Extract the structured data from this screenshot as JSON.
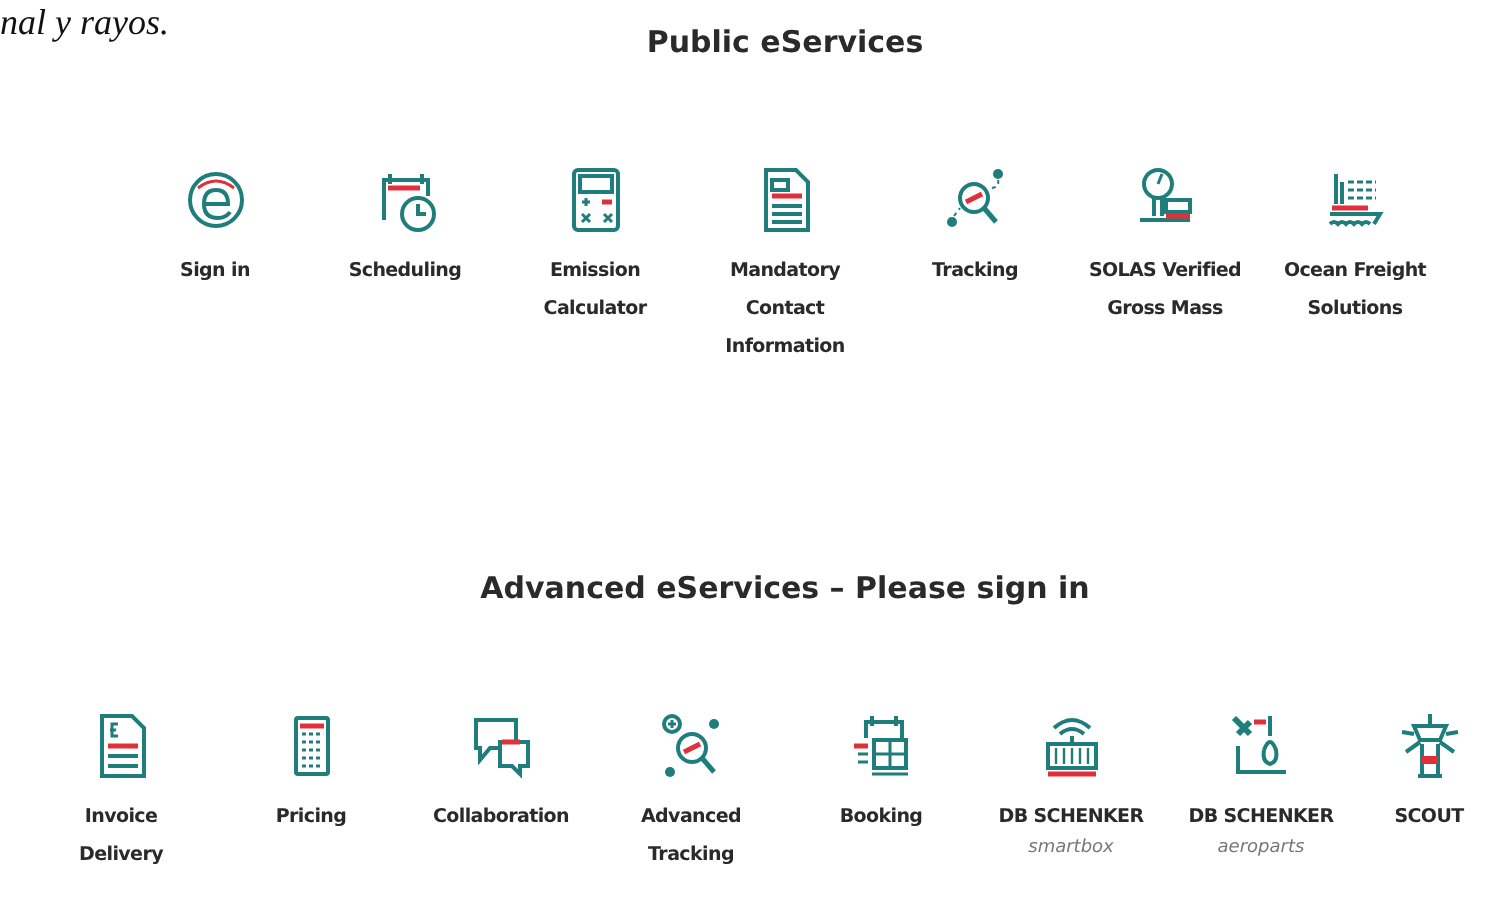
{
  "caption_fragment": "nal y rayos.",
  "sections": [
    {
      "title": "Public eServices",
      "items": [
        {
          "lines": [
            "Sign in"
          ]
        },
        {
          "lines": [
            "Scheduling"
          ]
        },
        {
          "lines": [
            "Emission",
            "Calculator"
          ]
        },
        {
          "lines": [
            "Mandatory",
            "Contact",
            "Information"
          ]
        },
        {
          "lines": [
            "Tracking"
          ]
        },
        {
          "lines": [
            "SOLAS Verified",
            "Gross Mass"
          ]
        },
        {
          "lines": [
            "Ocean Freight",
            "Solutions"
          ]
        }
      ]
    },
    {
      "title": "Advanced eServices – Please sign in",
      "items": [
        {
          "lines": [
            "Invoice",
            "Delivery"
          ]
        },
        {
          "lines": [
            "Pricing"
          ]
        },
        {
          "lines": [
            "Collaboration"
          ]
        },
        {
          "lines": [
            "Advanced",
            "Tracking"
          ]
        },
        {
          "lines": [
            "Booking"
          ]
        },
        {
          "lines": [
            "DB SCHENKER"
          ],
          "sublabel": "smartbox"
        },
        {
          "lines": [
            "DB SCHENKER"
          ],
          "sublabel": "aeroparts"
        },
        {
          "lines": [
            "SCOUT"
          ]
        }
      ]
    }
  ]
}
